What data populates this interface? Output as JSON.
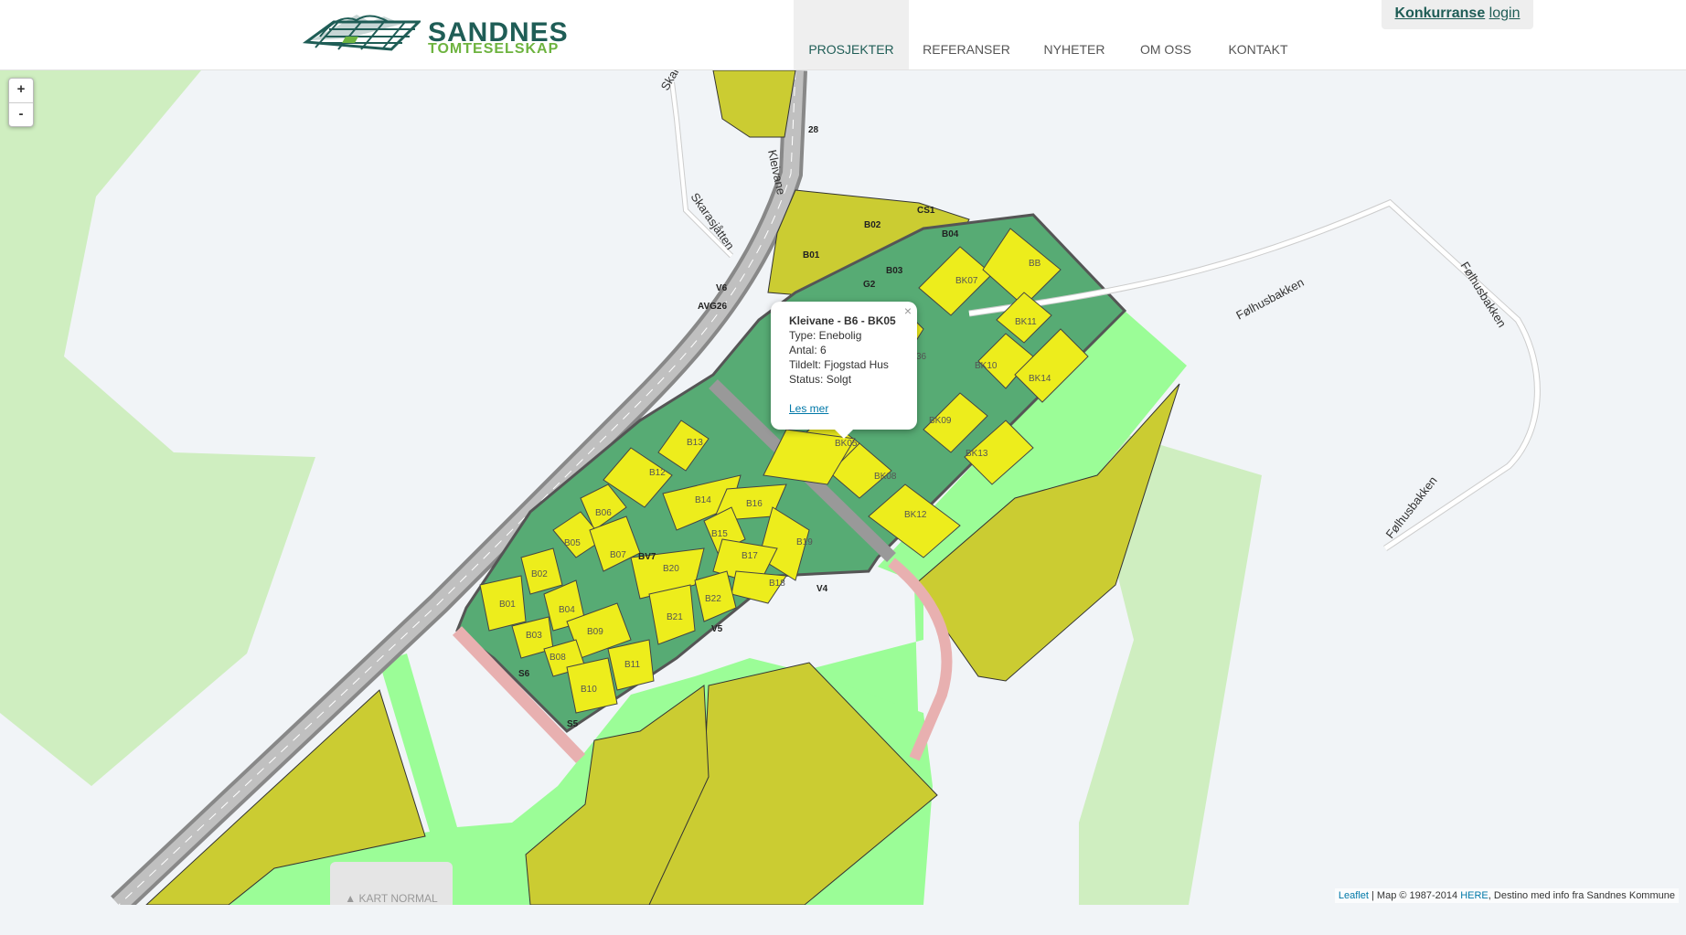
{
  "header": {
    "logo": {
      "line1": "SANDNES",
      "line2": "TOMTESELSKAP"
    },
    "login": {
      "konkurranse": "Konkurranse",
      "login": "login"
    },
    "nav": [
      {
        "label": "PROSJEKTER",
        "active": true
      },
      {
        "label": "REFERANSER",
        "active": false
      },
      {
        "label": "NYHETER",
        "active": false
      },
      {
        "label": "OM OSS",
        "active": false
      },
      {
        "label": "KONTAKT",
        "active": false
      }
    ]
  },
  "map": {
    "zoom_in": "+",
    "zoom_out": "-",
    "roads": {
      "skarasjatten": "Skarasjåtten",
      "skara": "Skara",
      "kleivane": "Kleivane",
      "folhus1": "Følhusbakken",
      "folhus2": "Følhusbakken",
      "folhus3": "Følhusbakken"
    },
    "labels": {
      "v6": "V6",
      "avg26": "AVG26",
      "n28": "28",
      "cs1": "CS1",
      "g2": "G2",
      "bv7": "BV7",
      "v4": "V4",
      "v5": "V5",
      "s6": "S6",
      "s5": "S5",
      "b01a": "B01",
      "b02a": "B02",
      "b03a": "B03",
      "b04a": "B04",
      "bb": "BB"
    },
    "plots": {
      "bk07": "BK07",
      "bk11": "BK11",
      "bk10": "BK10",
      "bk14": "BK14",
      "bk09": "BK09",
      "bk13": "BK13",
      "bk08": "BK08",
      "bk12": "BK12",
      "bk05": "BK05",
      "b36": "36",
      "b13": "B13",
      "b12": "B12",
      "b14": "B14",
      "b16": "B16",
      "b06": "B06",
      "b05": "B05",
      "b07": "B07",
      "b15": "B15",
      "b19": "B19",
      "b02": "B02",
      "b20": "B20",
      "b17": "B17",
      "b18": "B18",
      "b01": "B01",
      "b04": "B04",
      "b22": "B22",
      "b03": "B03",
      "b09": "B09",
      "b21": "B21",
      "b08": "B08",
      "b11": "B11",
      "b10": "B10"
    },
    "popup": {
      "title": "Kleivane - B6 - BK05",
      "type": "Type: Enebolig",
      "antal": "Antal: 6",
      "tildelt": "Tildelt: Fjogstad Hus",
      "status": "Status: Solgt",
      "link": "Les mer",
      "close": "×"
    },
    "kart_button": "▲ KART NORMAL",
    "attribution": {
      "leaflet": "Leaflet",
      "text1": " | Map © 1987-2014 ",
      "here": "HERE",
      "text2": ", Destino med info fra Sandnes Kommune"
    },
    "colors": {
      "background": "#f1f4f7",
      "light_green": "#cfeec0",
      "bright_green": "#9bfd97",
      "olive": "#cbcc32",
      "dark_green": "#57ab74",
      "yellow_plot": "#eded1c",
      "road_gray": "#999999",
      "accent": "#1f5d56"
    }
  }
}
